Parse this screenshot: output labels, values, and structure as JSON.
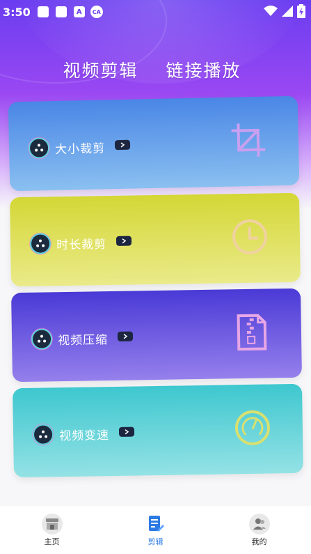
{
  "status_bar": {
    "time": "3:50",
    "a_badge": "A",
    "ca_badge": "CA"
  },
  "top_tabs": [
    {
      "label": "视频剪辑"
    },
    {
      "label": "链接播放"
    }
  ],
  "cards": [
    {
      "label": "大小裁剪",
      "icon": "crop-icon"
    },
    {
      "label": "时长裁剪",
      "icon": "clock-icon"
    },
    {
      "label": "视频压缩",
      "icon": "zip-file-icon"
    },
    {
      "label": "视频变速",
      "icon": "speedometer-icon"
    }
  ],
  "bottom_nav": [
    {
      "label": "主页",
      "icon": "shop-icon",
      "active": false
    },
    {
      "label": "剪辑",
      "icon": "edit-doc-icon",
      "active": true
    },
    {
      "label": "我的",
      "icon": "users-icon",
      "active": false
    }
  ],
  "colors": {
    "header_gradient_top": "#6a3df0",
    "card_1": "#4a86e6",
    "card_2": "#d4d735",
    "card_3": "#4a3ad6",
    "card_4": "#3ec7cf",
    "active_nav": "#2c7be5"
  }
}
